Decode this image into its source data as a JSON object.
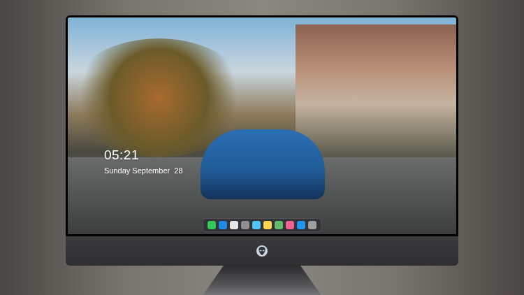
{
  "lock_screen": {
    "time": "05:21",
    "date": "Sunday September  28"
  },
  "dock": {
    "items": [
      {
        "color": "#34c759"
      },
      {
        "color": "#1e88e5"
      },
      {
        "color": "#e5e5e5"
      },
      {
        "color": "#8e8e93"
      },
      {
        "color": "#4fc3f7"
      },
      {
        "color": "#ffd54f"
      },
      {
        "color": "#66bb6a"
      },
      {
        "color": "#f06292"
      },
      {
        "color": "#2196f3"
      },
      {
        "color": "#9e9e9e"
      }
    ]
  }
}
